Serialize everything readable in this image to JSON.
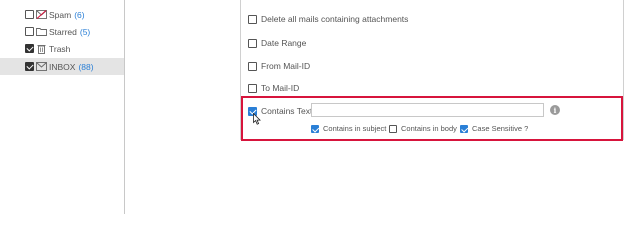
{
  "folders": [
    {
      "name": "Spam",
      "count": "(6)",
      "icon": "spam-icon"
    },
    {
      "name": "Starred",
      "count": "(5)",
      "icon": "folder-icon"
    },
    {
      "name": "Trash",
      "count": "",
      "icon": "trash-icon"
    },
    {
      "name": "INBOX",
      "count": "(88)",
      "icon": "envelope-icon"
    }
  ],
  "options": {
    "delete_attachments": "Delete all mails containing attachments",
    "date_range": "Date Range",
    "from_mail_id": "From Mail-ID",
    "to_mail_id": "To Mail-ID",
    "contains_text": "Contains Text"
  },
  "contains_text_input": {
    "value": ""
  },
  "sub_options": {
    "contains_in_subject": "Contains in subject",
    "contains_in_body": "Contains in body",
    "case_sensitive": "Case Sensitive ?"
  },
  "colors": {
    "accent": "#2a7fd6",
    "highlight_border": "#d7143c",
    "selected_row": "#e4e4e4"
  }
}
